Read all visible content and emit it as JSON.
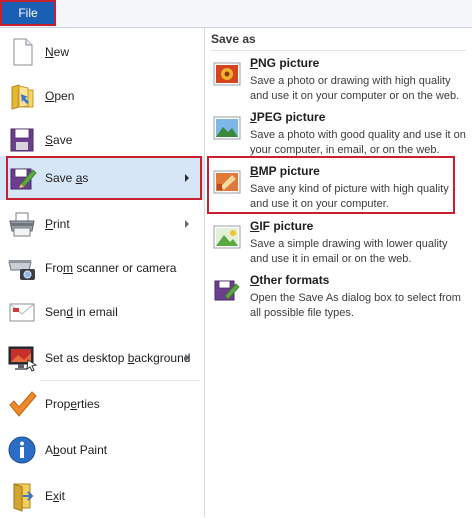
{
  "file_tab": {
    "label": "File"
  },
  "menu": {
    "items": [
      {
        "label": "New",
        "accel_index": 0,
        "icon": "new-document-icon",
        "submenu": false
      },
      {
        "label": "Open",
        "accel_index": 0,
        "icon": "open-folder-icon",
        "submenu": false
      },
      {
        "label": "Save",
        "accel_index": 0,
        "icon": "save-disk-icon",
        "submenu": false
      },
      {
        "label": "Save as",
        "accel_index": 5,
        "icon": "save-as-icon",
        "submenu": true
      },
      {
        "label": "Print",
        "accel_index": 0,
        "icon": "printer-icon",
        "submenu": true
      },
      {
        "label": "From scanner or camera",
        "accel_index": 3,
        "icon": "scanner-camera-icon",
        "submenu": false
      },
      {
        "label": "Send in email",
        "accel_index": 3,
        "icon": "email-icon",
        "submenu": false
      },
      {
        "label": "Set as desktop background",
        "accel_index": 15,
        "icon": "desktop-background-icon",
        "submenu": true
      },
      {
        "label": "Properties",
        "accel_index": 4,
        "icon": "checkmark-icon",
        "submenu": false
      },
      {
        "label": "About Paint",
        "accel_index": 1,
        "icon": "info-icon",
        "submenu": false
      },
      {
        "label": "Exit",
        "accel_index": 1,
        "icon": "exit-door-icon",
        "submenu": false
      }
    ]
  },
  "panel": {
    "title": "Save as",
    "options": [
      {
        "title": "PNG picture",
        "accel_index": 0,
        "icon": "png-picture-icon",
        "description": "Save a photo or drawing with high quality and use it on your computer or on the web."
      },
      {
        "title": "JPEG picture",
        "accel_index": 0,
        "icon": "jpeg-picture-icon",
        "description": "Save a photo with good quality and use it on your computer, in email, or on the web."
      },
      {
        "title": "BMP picture",
        "accel_index": 0,
        "icon": "bmp-picture-icon",
        "description": "Save any kind of picture with high quality and use it on your computer."
      },
      {
        "title": "GIF picture",
        "accel_index": 0,
        "icon": "gif-picture-icon",
        "description": "Save a simple drawing with lower quality and use it in email or on the web."
      },
      {
        "title": "Other formats",
        "accel_index": 0,
        "icon": "other-formats-icon",
        "description": "Open the Save As dialog box to select from all possible file types."
      }
    ]
  },
  "colors": {
    "file_tab": "#1b5fb4",
    "highlight_border": "#c8202f",
    "active_item": "#d6e6f7"
  }
}
